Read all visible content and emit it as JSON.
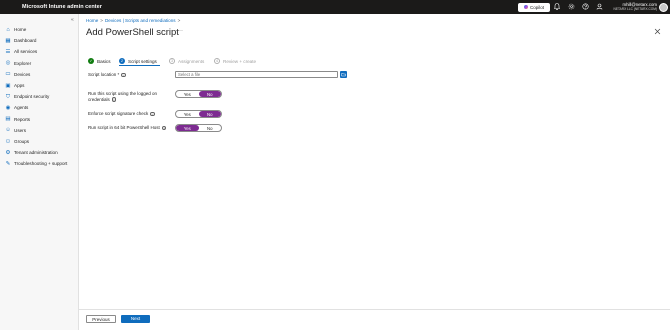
{
  "app": {
    "title": "Microsoft Intune admin center"
  },
  "topbar": {
    "copilot_label": "Copilot",
    "icons": [
      "bell-icon",
      "gear-icon",
      "help-icon",
      "feedback-icon"
    ],
    "user_email": "mhill@netarx.com",
    "user_org": "NETARX LLC (NETARX.COM)"
  },
  "sidebar": {
    "collapse_glyph": "«",
    "items": [
      {
        "label": "Home",
        "icon": "home-icon"
      },
      {
        "label": "Dashboard",
        "icon": "dashboard-icon"
      },
      {
        "label": "All services",
        "icon": "all-services-icon"
      },
      {
        "label": "Explorer",
        "icon": "explorer-icon"
      },
      {
        "label": "Devices",
        "icon": "devices-icon"
      },
      {
        "label": "Apps",
        "icon": "apps-icon"
      },
      {
        "label": "Endpoint security",
        "icon": "shield-icon"
      },
      {
        "label": "Agents",
        "icon": "agents-icon"
      },
      {
        "label": "Reports",
        "icon": "reports-icon"
      },
      {
        "label": "Users",
        "icon": "users-icon"
      },
      {
        "label": "Groups",
        "icon": "groups-icon"
      },
      {
        "label": "Tenant administration",
        "icon": "tenant-icon"
      },
      {
        "label": "Troubleshooting + support",
        "icon": "wrench-icon"
      }
    ]
  },
  "breadcrumb": {
    "home": "Home",
    "sep": ">",
    "current": "Devices | Scripts and remediations"
  },
  "page": {
    "title": "Add PowerShell script",
    "more": "···"
  },
  "wizard": {
    "steps": [
      {
        "label": "Basics",
        "state": "done",
        "marker": "✓"
      },
      {
        "label": "Script settings",
        "state": "active",
        "marker": "2"
      },
      {
        "label": "Assignments",
        "state": "pending",
        "marker": "3"
      },
      {
        "label": "Review + create",
        "state": "pending",
        "marker": "4"
      }
    ]
  },
  "form": {
    "script_location": {
      "label": "Script location *",
      "placeholder": "Select a file"
    },
    "run_logged_on": {
      "label_line1": "Run this script using the logged on",
      "label_line2": "credentials",
      "yes": "Yes",
      "no": "No",
      "selected": "No"
    },
    "signature_check": {
      "label": "Enforce script signature check",
      "yes": "Yes",
      "no": "No",
      "selected": "No"
    },
    "run_64bit": {
      "label": "Run script in 64 bit PowerShell Host",
      "yes": "Yes",
      "no": "No",
      "selected": "Yes"
    }
  },
  "footer": {
    "previous_label": "Previous",
    "next_label": "Next"
  },
  "colors": {
    "accent": "#0f6cbd",
    "toggle_on": "#7d2b91",
    "success": "#107c10",
    "topbar": "#1b1a19"
  }
}
